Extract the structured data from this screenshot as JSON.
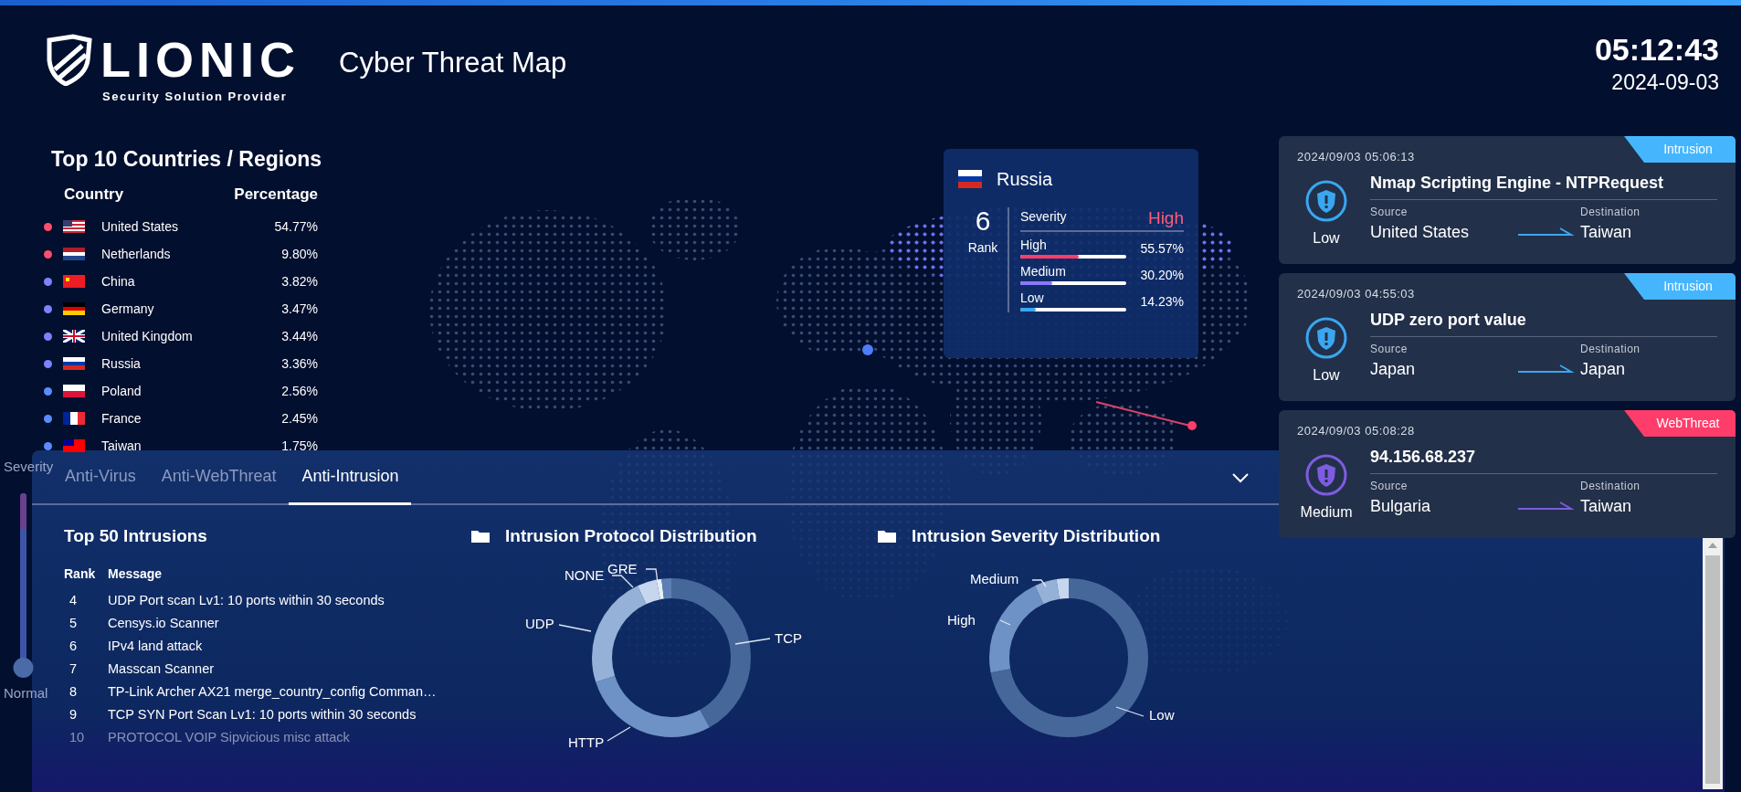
{
  "header": {
    "brand": "LIONIC",
    "brand_tagline": "Security Solution Provider",
    "title": "Cyber Threat Map",
    "time": "05:12:43",
    "date": "2024-09-03"
  },
  "countries": {
    "title": "Top 10 Countries / Regions",
    "columns": [
      "Country",
      "Percentage"
    ],
    "rows": [
      {
        "name": "United States",
        "percentage": "54.77%",
        "color": "#ff4d6d"
      },
      {
        "name": "Netherlands",
        "percentage": "9.80%",
        "color": "#ff4d6d"
      },
      {
        "name": "China",
        "percentage": "3.82%",
        "color": "#7b83ff"
      },
      {
        "name": "Germany",
        "percentage": "3.47%",
        "color": "#7b83ff"
      },
      {
        "name": "United Kingdom",
        "percentage": "3.44%",
        "color": "#7b83ff"
      },
      {
        "name": "Russia",
        "percentage": "3.36%",
        "color": "#7b83ff"
      },
      {
        "name": "Poland",
        "percentage": "2.56%",
        "color": "#5b8cff"
      },
      {
        "name": "France",
        "percentage": "2.45%",
        "color": "#5b8cff"
      },
      {
        "name": "Taiwan",
        "percentage": "1.75%",
        "color": "#5b8cff"
      }
    ]
  },
  "country_popup": {
    "name": "Russia",
    "rank": "6",
    "rank_label": "Rank",
    "severity_label": "Severity",
    "severity": {
      "label": "High",
      "color": "#ff5c7c"
    },
    "levels": [
      {
        "label": "High",
        "percentage": "55.57%",
        "level": 0.5557,
        "color": "#ff3d6a"
      },
      {
        "label": "Medium",
        "percentage": "30.20%",
        "level": 0.302,
        "color": "#8a78ff"
      },
      {
        "label": "Low",
        "percentage": "14.23%",
        "level": 0.1423,
        "color": "#3aa6f0"
      }
    ]
  },
  "events": [
    {
      "time": "2024/09/03 05:06:13",
      "tag": {
        "label": "Intrusion",
        "color": "#45b6fe"
      },
      "title": "Nmap Scripting Engine - NTPRequest",
      "severity": {
        "label": "Low",
        "color": "#3aa6f0"
      },
      "source_label": "Source",
      "source": "United States",
      "destination_label": "Destination",
      "destination": "Taiwan"
    },
    {
      "time": "2024/09/03 04:55:03",
      "tag": {
        "label": "Intrusion",
        "color": "#45b6fe"
      },
      "title": "UDP zero port value",
      "severity": {
        "label": "Low",
        "color": "#3aa6f0"
      },
      "source_label": "Source",
      "source": "Japan",
      "destination_label": "Destination",
      "destination": "Japan"
    },
    {
      "time": "2024/09/03 05:08:28",
      "tag": {
        "label": "WebThreat",
        "color": "#ff3d6a"
      },
      "title": "94.156.68.237",
      "severity": {
        "label": "Medium",
        "color": "#7d5ce0"
      },
      "source_label": "Source",
      "source": "Bulgaria",
      "destination_label": "Destination",
      "destination": "Taiwan"
    }
  ],
  "severity_slider": {
    "top_label": "Severity",
    "bottom_label": "Normal",
    "level": 0
  },
  "panel": {
    "tabs": [
      {
        "label": "Anti-Virus",
        "selected": false
      },
      {
        "label": "Anti-WebThreat",
        "selected": false
      },
      {
        "label": "Anti-Intrusion",
        "selected": true
      }
    ],
    "top_intrusions": {
      "title": "Top 50 Intrusions",
      "columns": [
        "Rank",
        "Message"
      ],
      "rows": [
        {
          "rank": "4",
          "message": "UDP Port scan Lv1: 10 ports within 30 seconds"
        },
        {
          "rank": "5",
          "message": "Censys.io Scanner"
        },
        {
          "rank": "6",
          "message": "IPv4 land attack"
        },
        {
          "rank": "7",
          "message": "Masscan Scanner"
        },
        {
          "rank": "8",
          "message": "TP-Link Archer AX21 merge_country_config Comman…"
        },
        {
          "rank": "9",
          "message": "TCP SYN Port Scan Lv1: 10 ports within 30 seconds"
        },
        {
          "rank": "10",
          "message": "PROTOCOL VOIP Sipvicious misc attack"
        }
      ]
    },
    "charts": [
      {
        "title": "Intrusion Protocol Distribution",
        "slice_labels": [
          "TCP",
          "HTTP",
          "UDP",
          "NONE",
          "GRE"
        ]
      },
      {
        "title": "Intrusion Severity Distribution",
        "slice_labels": [
          "Low",
          "High",
          "Medium"
        ]
      }
    ]
  }
}
